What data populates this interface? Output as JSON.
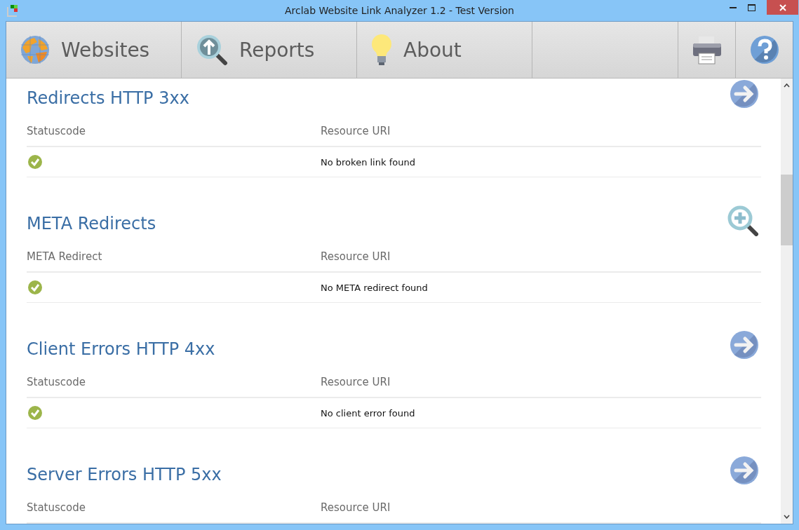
{
  "window": {
    "title": "Arclab Website Link Analyzer 1.2 - Test Version"
  },
  "toolbar": {
    "tabs": [
      {
        "label": "Websites"
      },
      {
        "label": "Reports"
      },
      {
        "label": "About"
      }
    ]
  },
  "sections": [
    {
      "title": "Redirects HTTP 3xx",
      "kind": "arrow",
      "columns": [
        "Statuscode",
        "Resource URI"
      ],
      "rows": [
        {
          "text": "No broken link found"
        }
      ]
    },
    {
      "title": "META Redirects",
      "kind": "zoom",
      "columns": [
        "META Redirect",
        "Resource URI"
      ],
      "rows": [
        {
          "text": "No META redirect found"
        }
      ]
    },
    {
      "title": "Client Errors HTTP 4xx",
      "kind": "arrow",
      "columns": [
        "Statuscode",
        "Resource URI"
      ],
      "rows": [
        {
          "text": "No client error found"
        }
      ]
    },
    {
      "title": "Server Errors HTTP 5xx",
      "kind": "arrow",
      "columns": [
        "Statuscode",
        "Resource URI"
      ]
    }
  ]
}
